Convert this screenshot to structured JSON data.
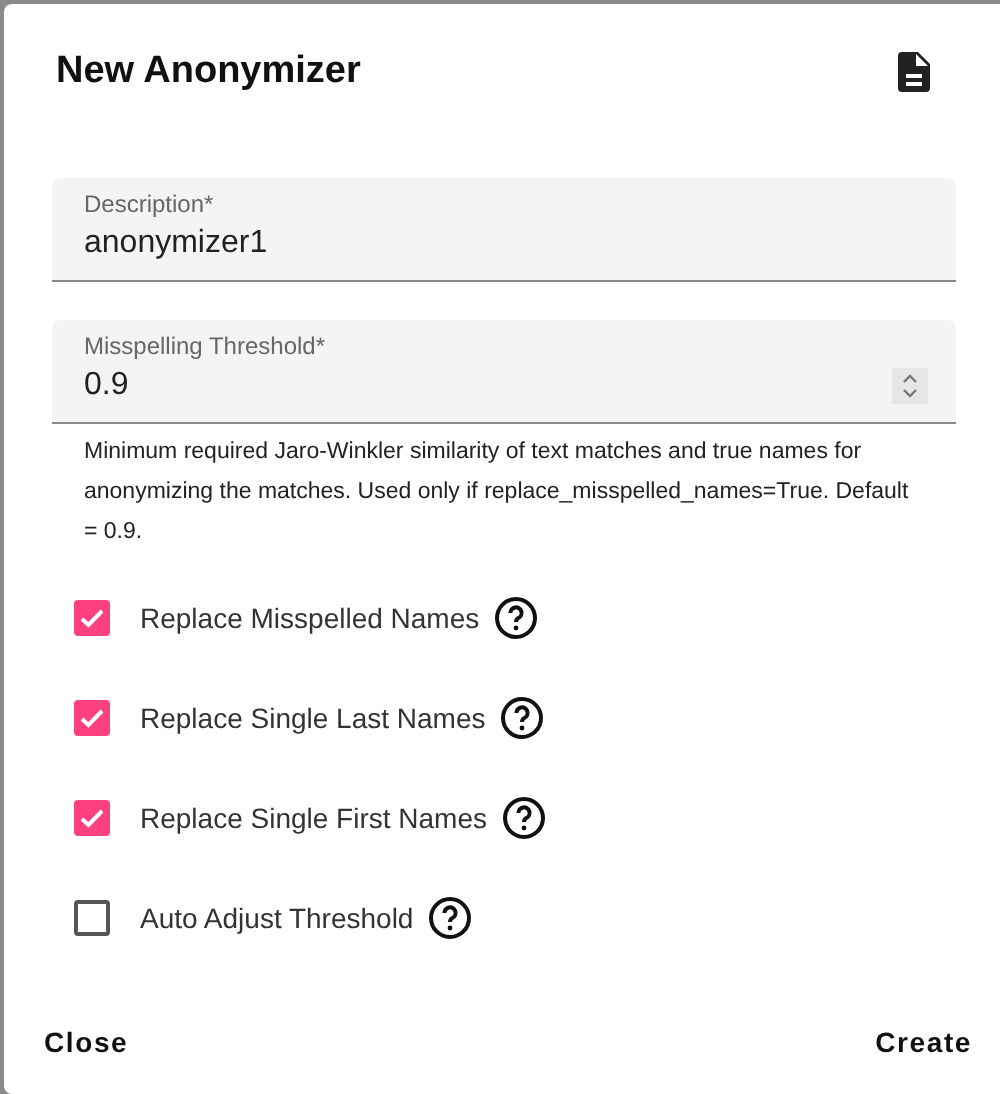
{
  "dialog": {
    "title": "New Anonymizer"
  },
  "fields": [
    {
      "label": "Description*",
      "value": "anonymizer1",
      "kind": "text"
    },
    {
      "label": "Misspelling Threshold*",
      "value": "0.9",
      "kind": "number",
      "hint": "Minimum required Jaro-Winkler similarity of text matches and true names for anonymizing the matches. Used only if replace_misspelled_names=True. Default = 0.9."
    }
  ],
  "options": [
    {
      "label": "Replace Misspelled Names",
      "checked": true
    },
    {
      "label": "Replace Single Last Names",
      "checked": true
    },
    {
      "label": "Replace Single First Names",
      "checked": true
    },
    {
      "label": "Auto Adjust Threshold",
      "checked": false
    }
  ],
  "buttons": [
    "Close",
    "Create"
  ]
}
